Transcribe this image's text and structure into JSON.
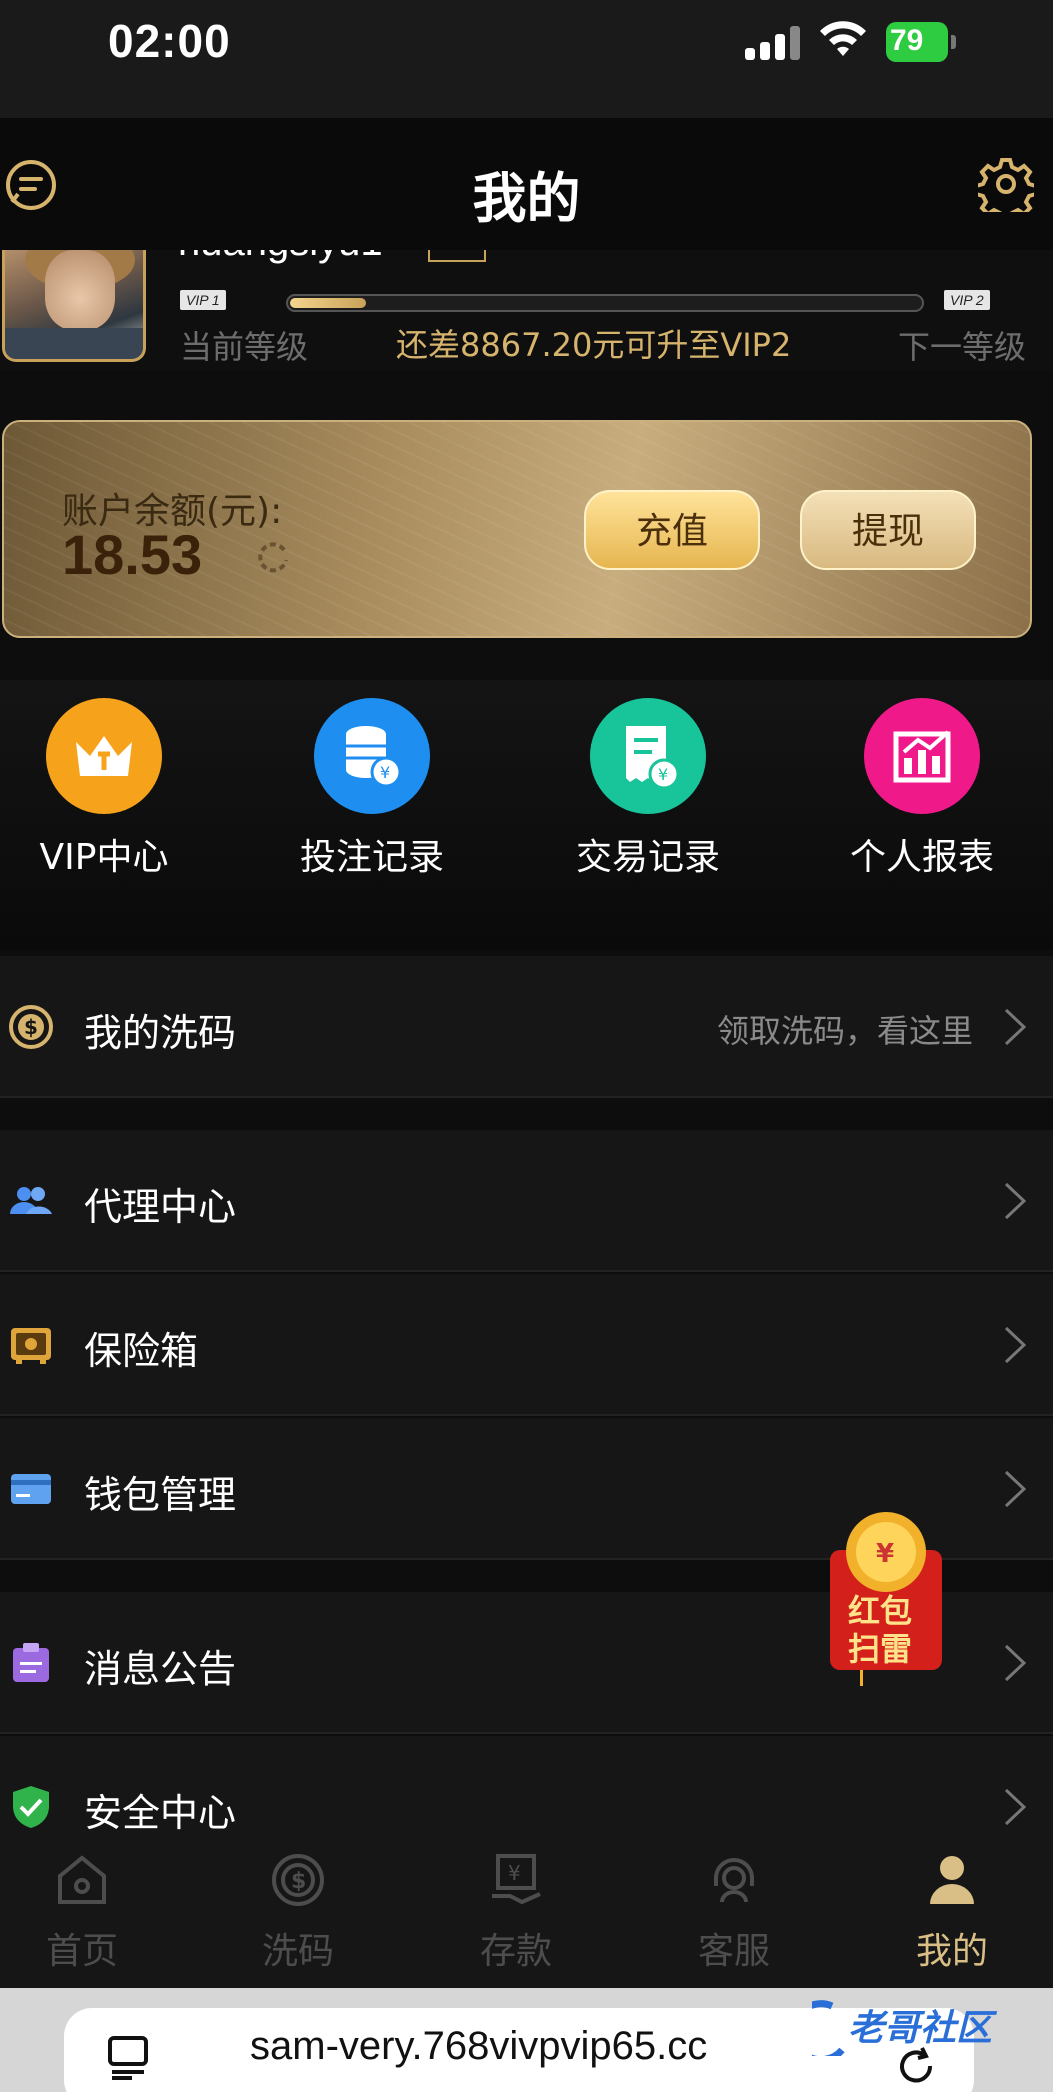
{
  "status_bar": {
    "time": "02:00",
    "battery": "79"
  },
  "header": {
    "title": "我的"
  },
  "profile": {
    "username": "huangsiyu1",
    "current_vip": "VIP 1",
    "next_vip": "VIP 2",
    "progress": 0.12,
    "current_level_label": "当前等级",
    "upgrade_text": "还差8867.20元可升至VIP2",
    "next_level_label": "下一等级"
  },
  "balance": {
    "label": "账户余额(元):",
    "value": "18.53",
    "recharge_label": "充值",
    "withdraw_label": "提现"
  },
  "quick_actions": [
    {
      "label": "VIP中心",
      "icon": "crown-icon",
      "color": "#f7a21b"
    },
    {
      "label": "投注记录",
      "icon": "coins-icon",
      "color": "#1e8ff0"
    },
    {
      "label": "交易记录",
      "icon": "receipt-icon",
      "color": "#18c49a"
    },
    {
      "label": "个人报表",
      "icon": "chart-icon",
      "color": "#f0198a"
    }
  ],
  "menu": {
    "rebate": {
      "label": "我的洗码",
      "hint": "领取洗码，看这里"
    },
    "agent": {
      "label": "代理中心"
    },
    "safe": {
      "label": "保险箱"
    },
    "wallet": {
      "label": "钱包管理"
    },
    "notice": {
      "label": "消息公告"
    },
    "security": {
      "label": "安全中心"
    }
  },
  "red_packet": {
    "label_top": "红包",
    "label_bottom": "扫雷"
  },
  "tabs": [
    {
      "label": "首页",
      "icon": "home-icon"
    },
    {
      "label": "洗码",
      "icon": "dollar-target-icon"
    },
    {
      "label": "存款",
      "icon": "deposit-icon"
    },
    {
      "label": "客服",
      "icon": "headset-icon"
    },
    {
      "label": "我的",
      "icon": "user-icon",
      "active": true
    }
  ],
  "browser": {
    "url": "sam-very.768vivpvip65.cc"
  },
  "watermark": {
    "text": "老哥社区"
  }
}
